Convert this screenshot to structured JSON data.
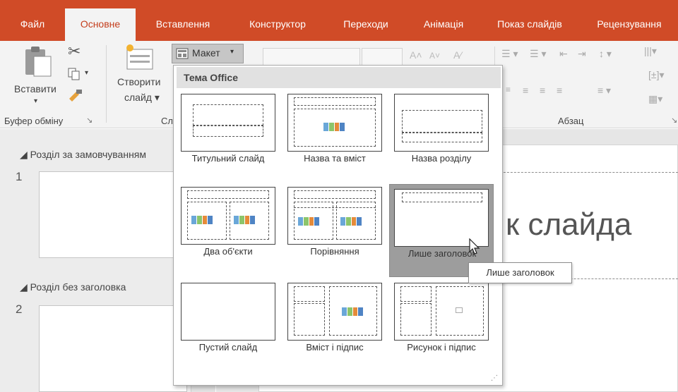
{
  "tabs": [
    {
      "label": "Файл",
      "active": false
    },
    {
      "label": "Основне",
      "active": true
    },
    {
      "label": "Вставлення",
      "active": false
    },
    {
      "label": "Конструктор",
      "active": false
    },
    {
      "label": "Переходи",
      "active": false
    },
    {
      "label": "Анімація",
      "active": false
    },
    {
      "label": "Показ слайдів",
      "active": false
    },
    {
      "label": "Рецензування",
      "active": false
    }
  ],
  "ribbon": {
    "paste_label": "Вставити",
    "clipboard_group": "Буфер обміну",
    "new_slide_line1": "Створити",
    "new_slide_line2": "слайд",
    "slides_group_partial": "Сл",
    "layout_button": "Макет",
    "paragraph_group": "Абзац"
  },
  "left_panel": {
    "sections": [
      {
        "label": "Розділ за замовчуванням",
        "slide_number": "1"
      },
      {
        "label": "Розділ без заголовка",
        "slide_number": "2"
      }
    ]
  },
  "slide": {
    "title_partial": "к слайда"
  },
  "layout_menu": {
    "header": "Тема Office",
    "layouts": [
      {
        "label": "Титульний слайд",
        "kind": "title"
      },
      {
        "label": "Назва та вміст",
        "kind": "title-content"
      },
      {
        "label": "Назва розділу",
        "kind": "section"
      },
      {
        "label": "Два об'єкти",
        "kind": "two-content"
      },
      {
        "label": "Порівняння",
        "kind": "comparison"
      },
      {
        "label": "Лише заголовок",
        "kind": "title-only",
        "hovered": true
      },
      {
        "label": "Пустий слайд",
        "kind": "blank"
      },
      {
        "label": "Вміст і підпис",
        "kind": "content-caption"
      },
      {
        "label": "Рисунок і підпис",
        "kind": "picture-caption"
      }
    ]
  },
  "tooltip": "Лише заголовок",
  "colors": {
    "accent": "#d04b27",
    "hover": "#9d9d9d"
  }
}
